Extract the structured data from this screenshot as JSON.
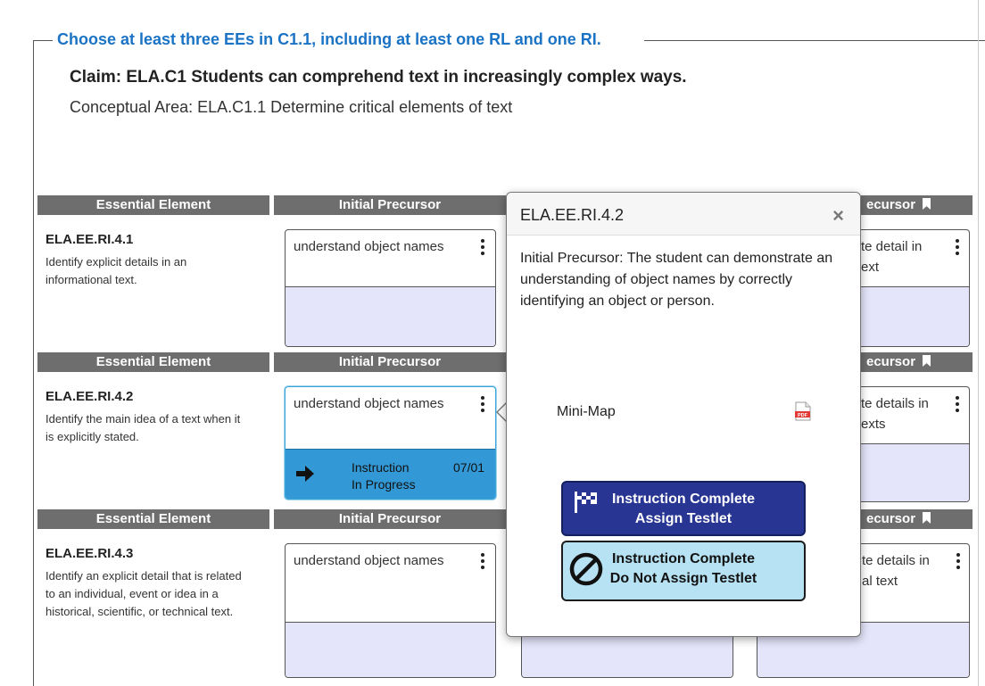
{
  "fieldset": {
    "legend": "Choose at least three EEs in C1.1, including at least one RL and one RI.",
    "claim": "Claim: ELA.C1 Students can comprehend text in increasingly complex ways.",
    "conceptual_area": "Conceptual Area: ELA.C1.1 Determine critical elements of text"
  },
  "columns": {
    "essential_element": "Essential Element",
    "initial_precursor": "Initial Precursor",
    "partial_right": "ecursor"
  },
  "rows": [
    {
      "code": "ELA.EE.RI.4.1",
      "description": "Identify explicit details in an informational text.",
      "initial_precursor_text": "understand object names",
      "right_card_line1": "te detail in",
      "right_card_line2": "ext"
    },
    {
      "code": "ELA.EE.RI.4.2",
      "description": "Identify the main idea of a text when it is explicitly stated.",
      "initial_precursor_text": "understand object names",
      "status_line1": "Instruction",
      "status_line2": "In Progress",
      "status_date": "07/01",
      "right_card_line1": "te details in",
      "right_card_line2": "exts"
    },
    {
      "code": "ELA.EE.RI.4.3",
      "description": "Identify an explicit detail that is related to an individual, event or idea in a historical, scientific, or technical text.",
      "initial_precursor_text": "understand object names",
      "right_card_line1": "te details in",
      "right_card_line2": "al text"
    }
  ],
  "popover": {
    "title": "ELA.EE.RI.4.2",
    "close": "×",
    "body": "Initial Precursor: The student can demonstrate an understanding of object names by correctly identifying an object or person.",
    "minimap_label": "Mini-Map",
    "pdf_icon_label": "PDF",
    "assign_line1": "Instruction Complete",
    "assign_line2": "Assign Testlet",
    "noassign_line1": "Instruction Complete",
    "noassign_line2": "Do Not Assign Testlet"
  },
  "colors": {
    "legend": "#1a73c4",
    "header_bg": "#6e6e6e",
    "status_bg": "#3399d6",
    "card_lower": "#e4e4fa",
    "assign_btn": "#283593",
    "noassign_btn": "#b7e2f3"
  },
  "icons": {
    "status": "arrow-right-icon",
    "assign": "checkered-flag-icon",
    "noassign": "prohibited-icon",
    "pdf": "pdf-file-icon",
    "bookmark": "bookmark-icon",
    "menu": "kebab-menu-icon"
  }
}
